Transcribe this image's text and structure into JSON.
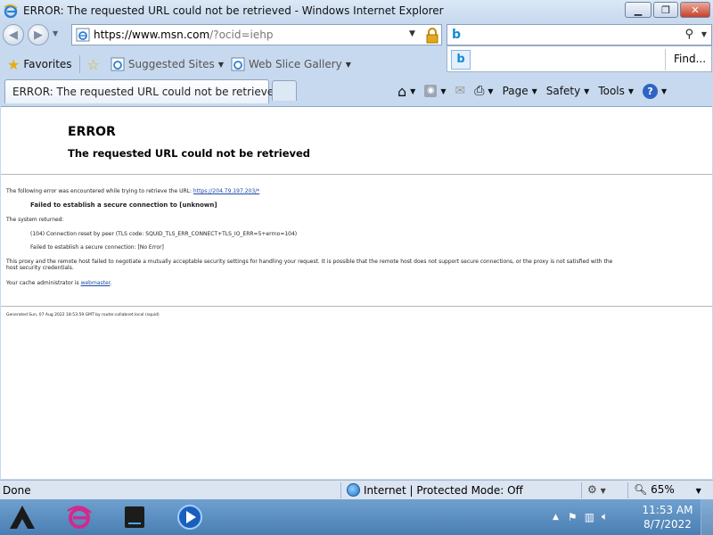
{
  "window": {
    "title": "ERROR: The requested URL could not be retrieved - Windows Internet Explorer",
    "min_icon": "minimize-icon",
    "max_icon": "maximize-icon",
    "close_icon": "close-icon"
  },
  "address": {
    "url_host": "https://www.msn.com",
    "url_rest": "/?ocid=iehp"
  },
  "search": {
    "provider": "b",
    "popup_provider": "b",
    "find_label": "Find..."
  },
  "favorites": {
    "favorites_label": "Favorites",
    "suggested_sites": "Suggested Sites",
    "web_slice_gallery": "Web Slice Gallery"
  },
  "tabs": {
    "active_title": "ERROR: The requested URL could not be retrieved"
  },
  "command_bar": {
    "page_label": "Page",
    "safety_label": "Safety",
    "tools_label": "Tools",
    "help_glyph": "?"
  },
  "content": {
    "title": "ERROR",
    "subtitle": "The requested URL could not be retrieved",
    "intro": "The following error was encountered while trying to retrieve the URL: ",
    "intro_link": "https://204.79.197.203/*",
    "failed_bold": "Failed to establish a secure connection to [unknown]",
    "system_returned": "The system returned:",
    "code_line": "(104) Connection reset by peer (TLS code: SQUID_TLS_ERR_CONNECT+TLS_IO_ERR=5+errno=104)",
    "failed_line": "Failed to establish a secure connection: [No Error]",
    "explain_1": "This proxy and the remote host failed to negotiate a mutually acceptable security settings for handling your request. It is possible that the remote host does not support secure connections, or the proxy is not satisfied with the",
    "explain_2": "host security credentials.",
    "admin_prefix": "Your cache administrator is ",
    "admin_link": "webmaster",
    "admin_suffix": ".",
    "generated": "Generated Sun, 07 Aug 2022 18:53:59 GMT by router.collabnet.local (squid)"
  },
  "statusbar": {
    "status": "Done",
    "zone": "Internet | Protected Mode: Off",
    "zoom": "65%"
  },
  "taskbar": {
    "time": "11:53 AM",
    "date": "8/7/2022"
  },
  "colors": {
    "accent": "#2f64c4",
    "link": "#1b4aa5",
    "close_button": "#c8402a"
  }
}
